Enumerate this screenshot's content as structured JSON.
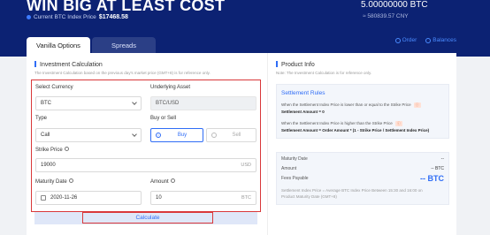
{
  "hero": {
    "title": "WIN BIG AT LEAST COST",
    "price_label": "Current BTC Index Price",
    "price_value": "$17468.58",
    "btc_amount": "5.00000000 BTC",
    "cny_amount": "≈ 580839.57 CNY"
  },
  "tabs": [
    {
      "label": "Vanilla Options",
      "active": true
    },
    {
      "label": "Spreads",
      "active": false
    }
  ],
  "links": {
    "order": "Order",
    "balances": "Balances"
  },
  "calc": {
    "title": "Investment Calculation",
    "note": "The Investment Calculation based on the previous day's market price (GMT+8) is for reference only.",
    "select_currency_label": "Select Currency",
    "currency_value": "BTC",
    "underlying_label": "Underlying Asset",
    "underlying_value": "BTC/USD",
    "type_label": "Type",
    "type_value": "Call",
    "buy_sell_label": "Buy or Sell",
    "buy_label": "Buy",
    "sell_label": "Sell",
    "strike_label": "Strike Price",
    "strike_value": "19000",
    "strike_unit": "USD",
    "maturity_label": "Maturity Date",
    "maturity_value": "2020-11-26",
    "amount_label": "Amount",
    "amount_value": "10",
    "amount_unit": "BTC",
    "calculate_label": "Calculate"
  },
  "product": {
    "title": "Product Info",
    "note": "Note: The Investment Calculation is for reference only.",
    "rules_title": "Settlement Rules",
    "rule1": "When the Settlement Index Price is lower than or equal to the Strike Price",
    "rule1_result": "Settlement Amount = 0",
    "rule2": "When the Settlement Index Price is higher than the Strike Price",
    "rule2_result": "Settlement Amount = Order Amount * (1 - Strike Price / Settlement Index Price)",
    "tag": "ⓘ",
    "maturity_label": "Maturity Date",
    "maturity_value": "--",
    "amount_label": "Amount",
    "amount_value": "-- BTC",
    "fees_label": "Fees Payable",
    "fees_value": "-- BTC",
    "footnote1": "Settlement Index Price = Average BTC Index Price Between 15:30 and 16:00 on",
    "footnote2": "Product Maturity Date (GMT+8)"
  },
  "colors": {
    "accent": "#2f6df6",
    "hero_bg": "#0c2273",
    "highlight": "#d9383a"
  }
}
